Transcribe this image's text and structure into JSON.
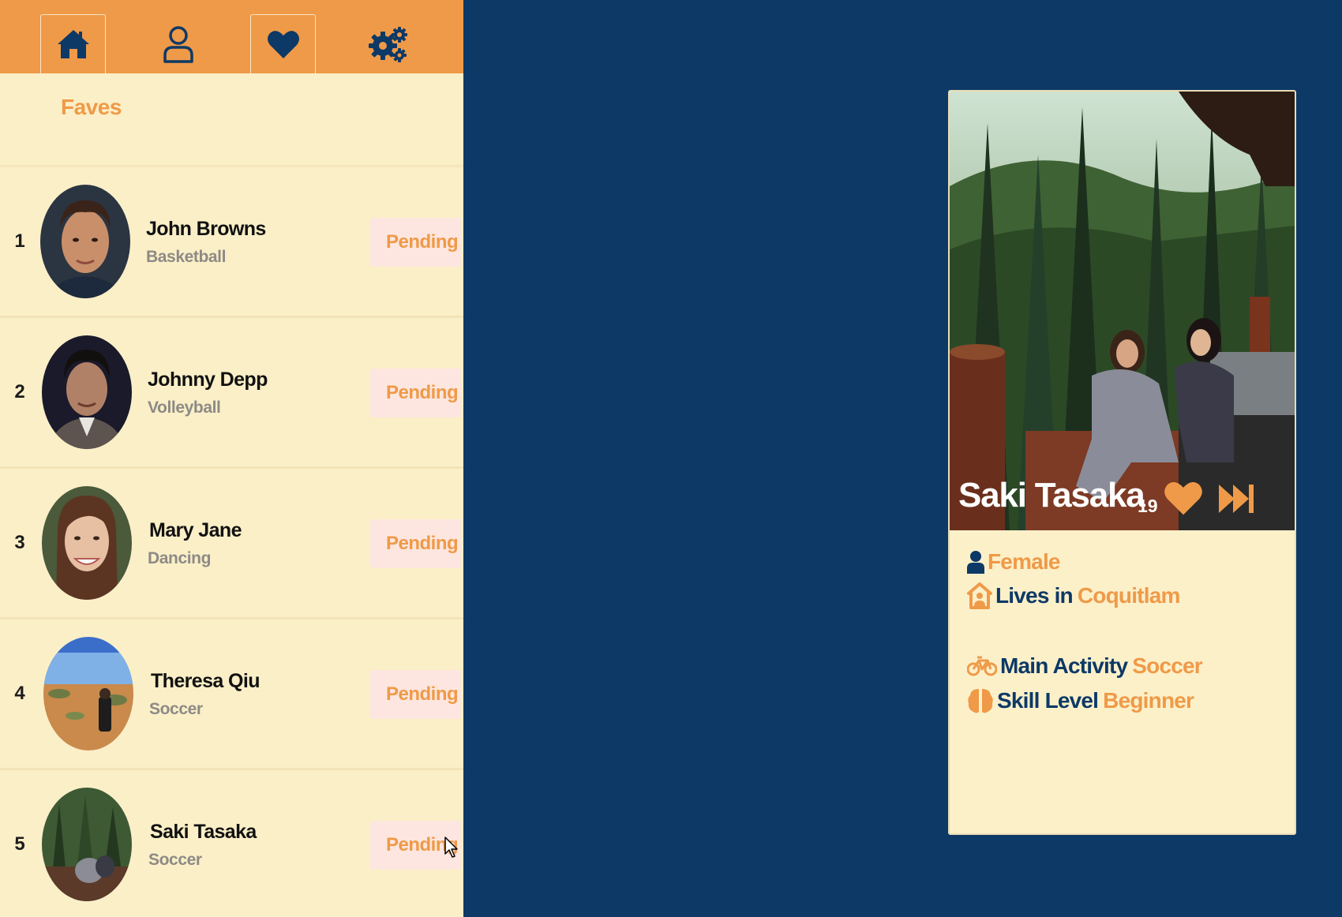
{
  "nav": {
    "items": [
      {
        "name": "home",
        "icon": "home-icon",
        "active": true
      },
      {
        "name": "profile",
        "icon": "user-icon",
        "active": false
      },
      {
        "name": "faves",
        "icon": "heart-icon",
        "active": true
      },
      {
        "name": "settings",
        "icon": "gears-icon",
        "active": false
      }
    ]
  },
  "faves": {
    "title": "Faves",
    "items": [
      {
        "rank": "1",
        "name": "John Browns",
        "activity": "Basketball",
        "status": "Pending"
      },
      {
        "rank": "2",
        "name": "Johnny Depp",
        "activity": "Volleyball",
        "status": "Pending"
      },
      {
        "rank": "3",
        "name": "Mary Jane",
        "activity": "Dancing",
        "status": "Pending"
      },
      {
        "rank": "4",
        "name": "Theresa Qiu",
        "activity": "Soccer",
        "status": "Pending"
      },
      {
        "rank": "5",
        "name": "Saki Tasaka",
        "activity": "Soccer",
        "status": "Pending"
      }
    ]
  },
  "profile": {
    "name": "Saki Tasaka",
    "age": "19",
    "gender": "Female",
    "lives_label": "Lives in",
    "lives_value": "Coquitlam",
    "activity_label": "Main Activity",
    "activity_value": "Soccer",
    "skill_label": "Skill Level",
    "skill_value": "Beginner"
  },
  "colors": {
    "accent": "#ef9a48",
    "navy": "#0d3966",
    "cream": "#fbefc7",
    "pending_bg": "#fde6df"
  }
}
